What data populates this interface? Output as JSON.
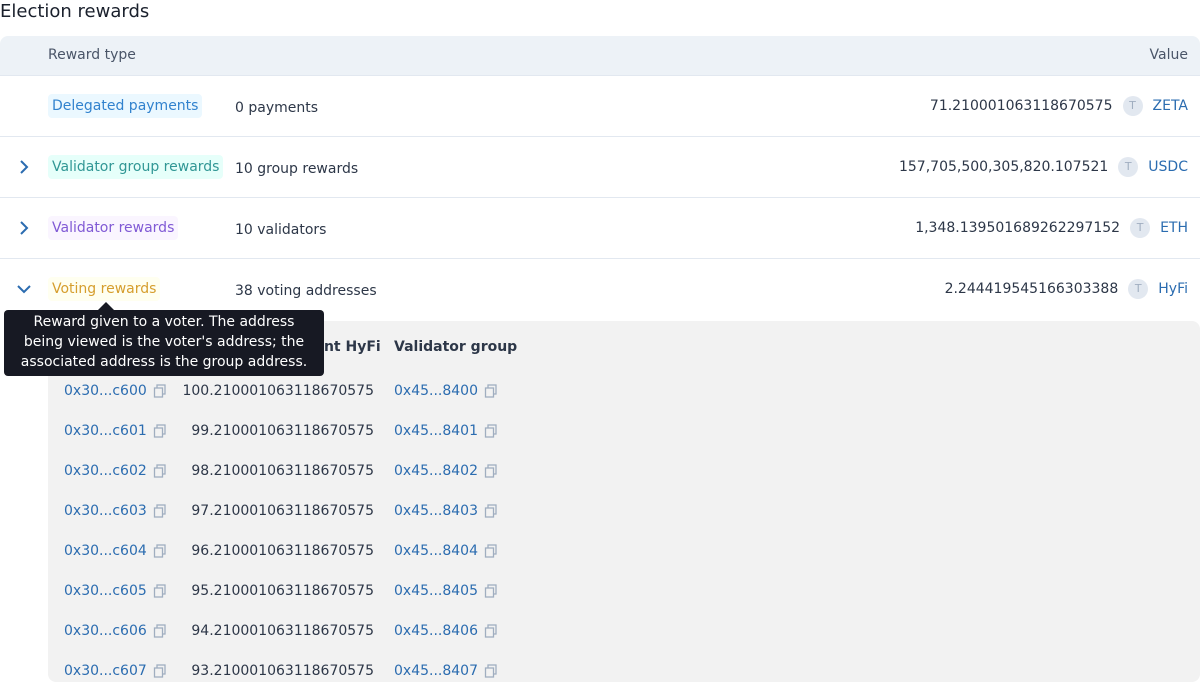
{
  "page_title": "Election rewards",
  "table": {
    "header_type": "Reward type",
    "header_value": "Value"
  },
  "rows": [
    {
      "tag": "Delegated payments",
      "summary": "0 payments",
      "amount": "71.210001063118670575",
      "token_icon": "T",
      "token": "ZETA",
      "expandable": false
    },
    {
      "tag": "Validator group rewards",
      "summary": "10 group rewards",
      "amount": "157,705,500,305,820.107521",
      "token_icon": "T",
      "token": "USDC",
      "expandable": true
    },
    {
      "tag": "Validator rewards",
      "summary": "10 validators",
      "amount": "1,348.139501689262297152",
      "token_icon": "T",
      "token": "ETH",
      "expandable": true
    },
    {
      "tag": "Voting rewards",
      "summary": "38 voting addresses",
      "amount": "2.244419545166303388",
      "token_icon": "T",
      "token": "HyFi",
      "expandable": true
    }
  ],
  "tooltip": "Reward given to a voter. The address being viewed is the voter's address; the associated address is the group address.",
  "sub_table": {
    "header_amount": "unt HyFi",
    "header_group": "Validator group",
    "rows": [
      {
        "address": "0x30...c600",
        "amount": "100.210001063118670575",
        "group": "0x45...8400"
      },
      {
        "address": "0x30...c601",
        "amount": "99.210001063118670575",
        "group": "0x45...8401"
      },
      {
        "address": "0x30...c602",
        "amount": "98.210001063118670575",
        "group": "0x45...8402"
      },
      {
        "address": "0x30...c603",
        "amount": "97.210001063118670575",
        "group": "0x45...8403"
      },
      {
        "address": "0x30...c604",
        "amount": "96.210001063118670575",
        "group": "0x45...8404"
      },
      {
        "address": "0x30...c605",
        "amount": "95.210001063118670575",
        "group": "0x45...8405"
      },
      {
        "address": "0x30...c606",
        "amount": "94.210001063118670575",
        "group": "0x45...8406"
      },
      {
        "address": "0x30...c607",
        "amount": "93.210001063118670575",
        "group": "0x45...8407"
      }
    ]
  }
}
